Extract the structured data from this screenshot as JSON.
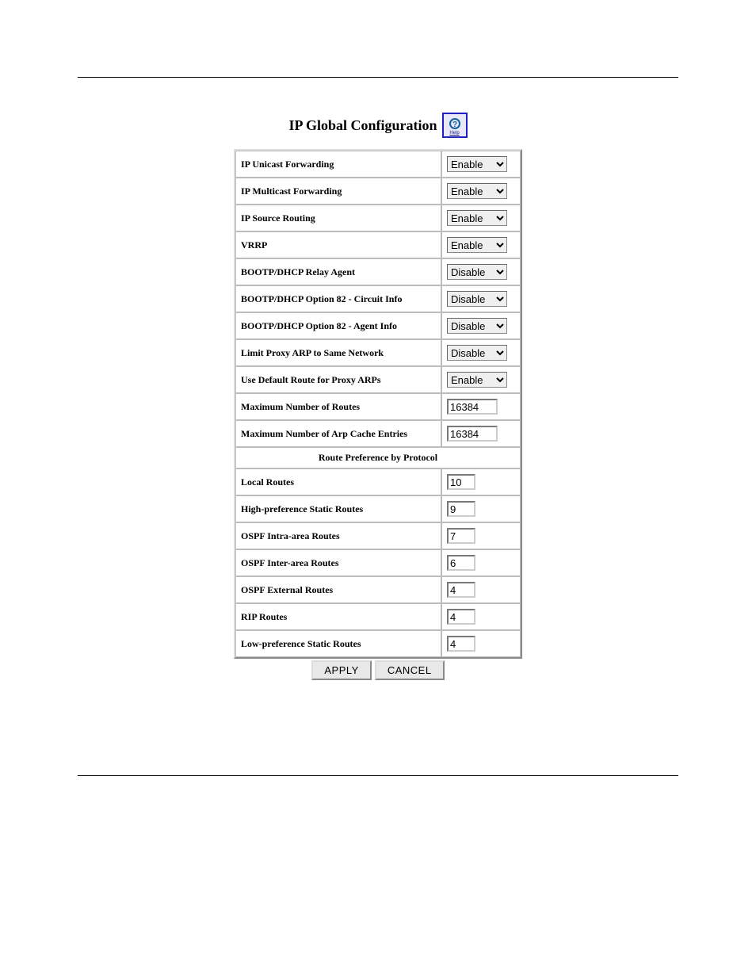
{
  "header": {
    "title": "IP Global Configuration",
    "help_label": "Help"
  },
  "rows": {
    "ip_unicast_forwarding": {
      "label": "IP Unicast Forwarding",
      "value": "Enable"
    },
    "ip_multicast_forwarding": {
      "label": "IP Multicast Forwarding",
      "value": "Enable"
    },
    "ip_source_routing": {
      "label": "IP Source Routing",
      "value": "Enable"
    },
    "vrrp": {
      "label": "VRRP",
      "value": "Enable"
    },
    "bootp_dhcp_relay_agent": {
      "label": "BOOTP/DHCP Relay Agent",
      "value": "Disable"
    },
    "bootp_dhcp_opt82_circuit": {
      "label": "BOOTP/DHCP Option 82 - Circuit Info",
      "value": "Disable"
    },
    "bootp_dhcp_opt82_agent": {
      "label": "BOOTP/DHCP Option 82 - Agent Info",
      "value": "Disable"
    },
    "limit_proxy_arp_same_net": {
      "label": "Limit Proxy ARP to Same Network",
      "value": "Disable"
    },
    "use_default_route_proxy_arps": {
      "label": "Use Default Route for Proxy ARPs",
      "value": "Enable"
    },
    "max_routes": {
      "label": "Maximum Number of Routes",
      "value": "16384"
    },
    "max_arp_cache": {
      "label": "Maximum Number of Arp Cache Entries",
      "value": "16384"
    }
  },
  "section_header": "Route Preference by Protocol",
  "pref_rows": {
    "local_routes": {
      "label": "Local Routes",
      "value": "10"
    },
    "high_pref_static": {
      "label": "High-preference Static Routes",
      "value": "9"
    },
    "ospf_intra": {
      "label": "OSPF Intra-area Routes",
      "value": "7"
    },
    "ospf_inter": {
      "label": "OSPF Inter-area Routes",
      "value": "6"
    },
    "ospf_external": {
      "label": "OSPF External Routes",
      "value": "4"
    },
    "rip_routes": {
      "label": "RIP Routes",
      "value": "4"
    },
    "low_pref_static": {
      "label": "Low-preference Static Routes",
      "value": "4"
    }
  },
  "buttons": {
    "apply": "APPLY",
    "cancel": "CANCEL"
  },
  "select_options": [
    "Enable",
    "Disable"
  ]
}
